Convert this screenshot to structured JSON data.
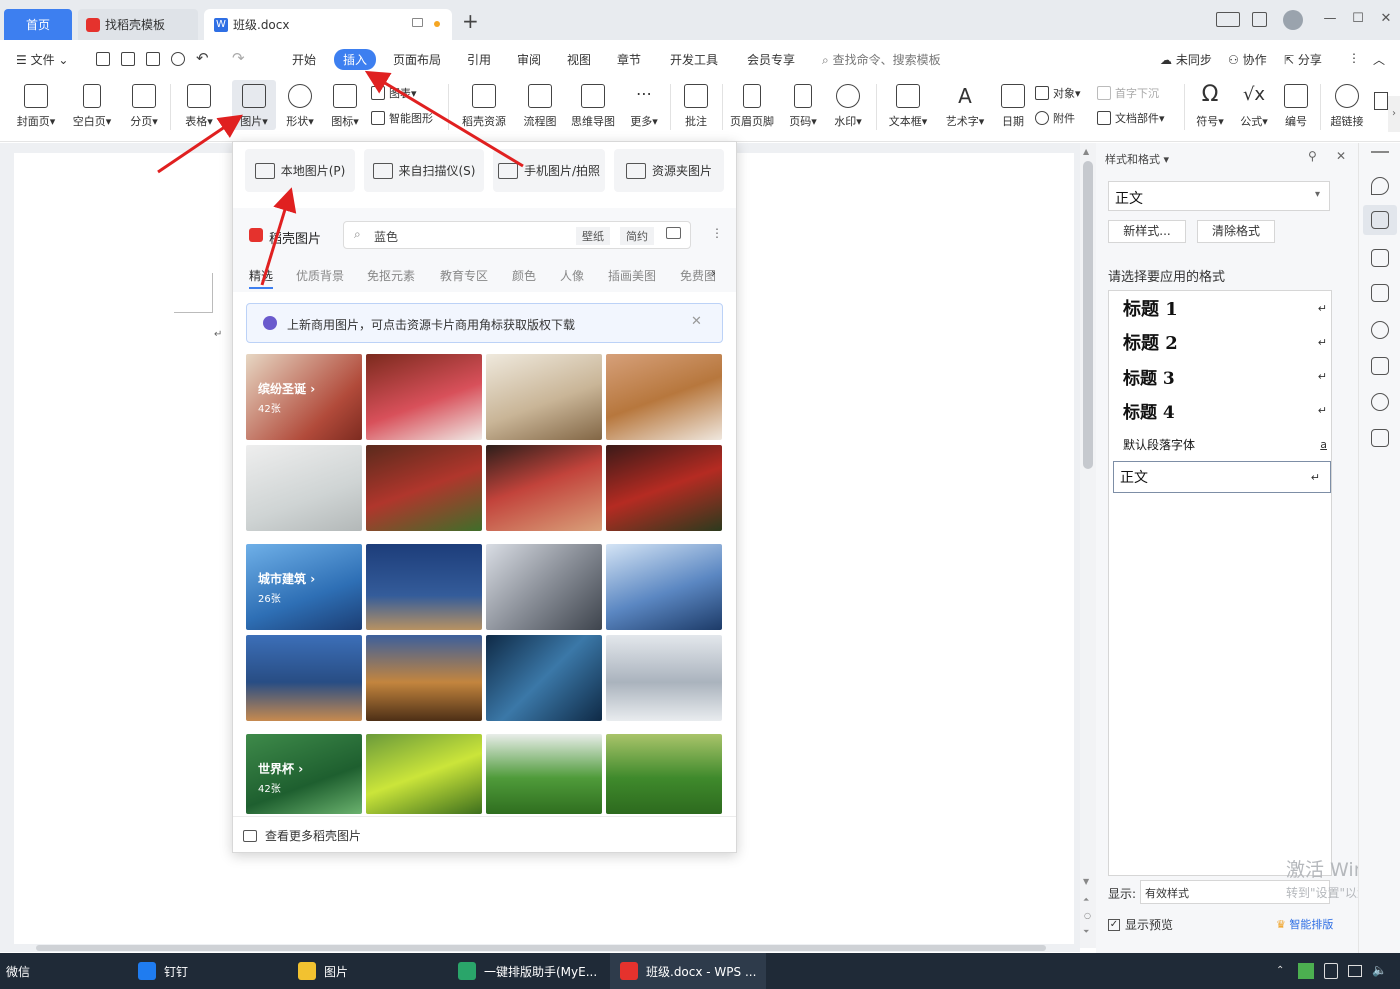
{
  "titlebar": {
    "tabs": [
      {
        "label": "首页"
      },
      {
        "label": "找稻壳模板"
      },
      {
        "label": "班级.docx"
      }
    ]
  },
  "menubar": {
    "file": "文件",
    "items": [
      "开始",
      "插入",
      "页面布局",
      "引用",
      "审阅",
      "视图",
      "章节",
      "开发工具",
      "会员专享"
    ],
    "search_placeholder": "查找命令、搜索模板",
    "sync": "未同步",
    "collab": "协作",
    "share": "分享"
  },
  "ribbon": {
    "cover": "封面页",
    "blank": "空白页",
    "pagebreak": "分页",
    "table": "表格",
    "picture": "图片",
    "shape": "形状",
    "icon": "图标",
    "chart": "图表",
    "smart": "智能图形",
    "docer": "稻壳资源",
    "flow": "流程图",
    "mind": "思维导图",
    "more": "更多",
    "comment": "批注",
    "headerfooter": "页眉页脚",
    "pagenum": "页码",
    "watermark": "水印",
    "textbox": "文本框",
    "wordart": "艺术字",
    "date": "日期",
    "object": "对象",
    "attach": "附件",
    "dropcap": "首字下沉",
    "docpart": "文档部件",
    "symbol": "符号",
    "formula": "公式",
    "numbering": "编号",
    "hyperlink": "超链接"
  },
  "popup": {
    "sources": [
      "本地图片(P)",
      "来自扫描仪(S)",
      "手机图片/拍照",
      "资源夹图片"
    ],
    "brand": "稻壳图片",
    "search_value": "蓝色",
    "tags": [
      "壁纸",
      "简约"
    ],
    "categories": [
      "精选",
      "优质背景",
      "免抠元素",
      "教育专区",
      "颜色",
      "人像",
      "插画美图",
      "免费图"
    ],
    "notice": "上新商用图片，可点击资源卡片商用角标获取版权下载",
    "groups": [
      {
        "title": "缤纷圣诞",
        "count": "42张"
      },
      {
        "title": "城市建筑",
        "count": "26张"
      },
      {
        "title": "世界杯",
        "count": "42张"
      }
    ],
    "more_link": "查看更多稻壳图片"
  },
  "rightpanel": {
    "title": "样式和格式",
    "current_style": "正文",
    "new_style": "新样式...",
    "clear_format": "清除格式",
    "prompt": "请选择要应用的格式",
    "styles": [
      {
        "name": "标题  1"
      },
      {
        "name": "标题  2"
      },
      {
        "name": "标题  3"
      },
      {
        "name": "标题  4"
      },
      {
        "name": "默认段落字体"
      },
      {
        "name": "正文"
      }
    ],
    "show_label": "显示:",
    "show_value": "有效样式",
    "preview": "显示预览",
    "smart_layout": "智能排版"
  },
  "watermark": {
    "line1": "激活 Windo",
    "line2": "转到\"设置\"以激活"
  },
  "taskbar": {
    "items": [
      "微信",
      "钉钉",
      "图片",
      "一键排版助手(MyE...",
      "班级.docx - WPS ..."
    ]
  },
  "colors": {
    "accent": "#3d7ff0",
    "arrow": "#e02020",
    "taskbar": "#1f2a37"
  }
}
